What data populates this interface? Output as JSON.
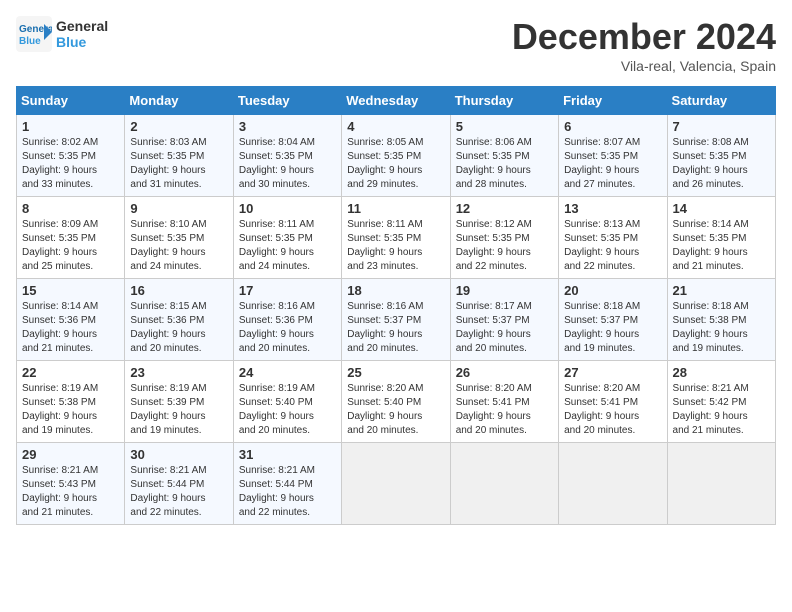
{
  "header": {
    "logo_line1": "General",
    "logo_line2": "Blue",
    "month": "December 2024",
    "location": "Vila-real, Valencia, Spain"
  },
  "weekdays": [
    "Sunday",
    "Monday",
    "Tuesday",
    "Wednesday",
    "Thursday",
    "Friday",
    "Saturday"
  ],
  "weeks": [
    [
      {
        "day": "1",
        "info": "Sunrise: 8:02 AM\nSunset: 5:35 PM\nDaylight: 9 hours\nand 33 minutes."
      },
      {
        "day": "2",
        "info": "Sunrise: 8:03 AM\nSunset: 5:35 PM\nDaylight: 9 hours\nand 31 minutes."
      },
      {
        "day": "3",
        "info": "Sunrise: 8:04 AM\nSunset: 5:35 PM\nDaylight: 9 hours\nand 30 minutes."
      },
      {
        "day": "4",
        "info": "Sunrise: 8:05 AM\nSunset: 5:35 PM\nDaylight: 9 hours\nand 29 minutes."
      },
      {
        "day": "5",
        "info": "Sunrise: 8:06 AM\nSunset: 5:35 PM\nDaylight: 9 hours\nand 28 minutes."
      },
      {
        "day": "6",
        "info": "Sunrise: 8:07 AM\nSunset: 5:35 PM\nDaylight: 9 hours\nand 27 minutes."
      },
      {
        "day": "7",
        "info": "Sunrise: 8:08 AM\nSunset: 5:35 PM\nDaylight: 9 hours\nand 26 minutes."
      }
    ],
    [
      {
        "day": "8",
        "info": "Sunrise: 8:09 AM\nSunset: 5:35 PM\nDaylight: 9 hours\nand 25 minutes."
      },
      {
        "day": "9",
        "info": "Sunrise: 8:10 AM\nSunset: 5:35 PM\nDaylight: 9 hours\nand 24 minutes."
      },
      {
        "day": "10",
        "info": "Sunrise: 8:11 AM\nSunset: 5:35 PM\nDaylight: 9 hours\nand 24 minutes."
      },
      {
        "day": "11",
        "info": "Sunrise: 8:11 AM\nSunset: 5:35 PM\nDaylight: 9 hours\nand 23 minutes."
      },
      {
        "day": "12",
        "info": "Sunrise: 8:12 AM\nSunset: 5:35 PM\nDaylight: 9 hours\nand 22 minutes."
      },
      {
        "day": "13",
        "info": "Sunrise: 8:13 AM\nSunset: 5:35 PM\nDaylight: 9 hours\nand 22 minutes."
      },
      {
        "day": "14",
        "info": "Sunrise: 8:14 AM\nSunset: 5:35 PM\nDaylight: 9 hours\nand 21 minutes."
      }
    ],
    [
      {
        "day": "15",
        "info": "Sunrise: 8:14 AM\nSunset: 5:36 PM\nDaylight: 9 hours\nand 21 minutes."
      },
      {
        "day": "16",
        "info": "Sunrise: 8:15 AM\nSunset: 5:36 PM\nDaylight: 9 hours\nand 20 minutes."
      },
      {
        "day": "17",
        "info": "Sunrise: 8:16 AM\nSunset: 5:36 PM\nDaylight: 9 hours\nand 20 minutes."
      },
      {
        "day": "18",
        "info": "Sunrise: 8:16 AM\nSunset: 5:37 PM\nDaylight: 9 hours\nand 20 minutes."
      },
      {
        "day": "19",
        "info": "Sunrise: 8:17 AM\nSunset: 5:37 PM\nDaylight: 9 hours\nand 20 minutes."
      },
      {
        "day": "20",
        "info": "Sunrise: 8:18 AM\nSunset: 5:37 PM\nDaylight: 9 hours\nand 19 minutes."
      },
      {
        "day": "21",
        "info": "Sunrise: 8:18 AM\nSunset: 5:38 PM\nDaylight: 9 hours\nand 19 minutes."
      }
    ],
    [
      {
        "day": "22",
        "info": "Sunrise: 8:19 AM\nSunset: 5:38 PM\nDaylight: 9 hours\nand 19 minutes."
      },
      {
        "day": "23",
        "info": "Sunrise: 8:19 AM\nSunset: 5:39 PM\nDaylight: 9 hours\nand 19 minutes."
      },
      {
        "day": "24",
        "info": "Sunrise: 8:19 AM\nSunset: 5:40 PM\nDaylight: 9 hours\nand 20 minutes."
      },
      {
        "day": "25",
        "info": "Sunrise: 8:20 AM\nSunset: 5:40 PM\nDaylight: 9 hours\nand 20 minutes."
      },
      {
        "day": "26",
        "info": "Sunrise: 8:20 AM\nSunset: 5:41 PM\nDaylight: 9 hours\nand 20 minutes."
      },
      {
        "day": "27",
        "info": "Sunrise: 8:20 AM\nSunset: 5:41 PM\nDaylight: 9 hours\nand 20 minutes."
      },
      {
        "day": "28",
        "info": "Sunrise: 8:21 AM\nSunset: 5:42 PM\nDaylight: 9 hours\nand 21 minutes."
      }
    ],
    [
      {
        "day": "29",
        "info": "Sunrise: 8:21 AM\nSunset: 5:43 PM\nDaylight: 9 hours\nand 21 minutes."
      },
      {
        "day": "30",
        "info": "Sunrise: 8:21 AM\nSunset: 5:44 PM\nDaylight: 9 hours\nand 22 minutes."
      },
      {
        "day": "31",
        "info": "Sunrise: 8:21 AM\nSunset: 5:44 PM\nDaylight: 9 hours\nand 22 minutes."
      },
      {
        "day": "",
        "info": ""
      },
      {
        "day": "",
        "info": ""
      },
      {
        "day": "",
        "info": ""
      },
      {
        "day": "",
        "info": ""
      }
    ]
  ]
}
